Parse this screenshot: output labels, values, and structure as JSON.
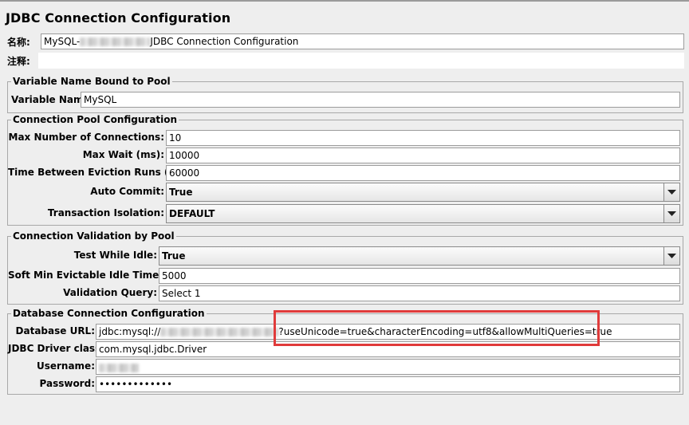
{
  "header": {
    "title": "JDBC Connection Configuration"
  },
  "name_row": {
    "label": "名称:",
    "value_prefix": "MySQL-",
    "value_suffix": "JDBC Connection Configuration"
  },
  "comment_row": {
    "label": "注释:",
    "value": ""
  },
  "variable_group": {
    "legend": "Variable Name Bound to Pool",
    "variable_name_label": "Variable Name:",
    "variable_name_value": "MySQL"
  },
  "pool_group": {
    "legend": "Connection Pool Configuration",
    "max_connections_label": "Max Number of Connections:",
    "max_connections_value": "10",
    "max_wait_label": "Max Wait (ms):",
    "max_wait_value": "10000",
    "eviction_label": "Time Between Eviction Runs (ms):",
    "eviction_value": "60000",
    "auto_commit_label": "Auto Commit:",
    "auto_commit_value": "True",
    "isolation_label": "Transaction Isolation:",
    "isolation_value": "DEFAULT"
  },
  "validation_group": {
    "legend": "Connection Validation by Pool",
    "test_idle_label": "Test While Idle:",
    "test_idle_value": "True",
    "soft_min_label": "Soft Min Evictable Idle Time(ms):",
    "soft_min_value": "5000",
    "validation_query_label": "Validation Query:",
    "validation_query_value": "Select 1"
  },
  "db_group": {
    "legend": "Database Connection Configuration",
    "url_label": "Database URL:",
    "url_prefix": "jdbc:mysql://",
    "url_suffix": "?useUnicode=true&characterEncoding=utf8&allowMultiQueries=true",
    "driver_label": "JDBC Driver class:",
    "driver_value": "com.mysql.jdbc.Driver",
    "username_label": "Username:",
    "username_value": "",
    "password_label": "Password:",
    "password_value": "•••••••••••••"
  },
  "colors": {
    "highlight": "#e03b3b",
    "background": "#eeeeee",
    "field_border": "#9c9c9c"
  },
  "icons": {
    "dropdown": "chevron-down-icon"
  }
}
